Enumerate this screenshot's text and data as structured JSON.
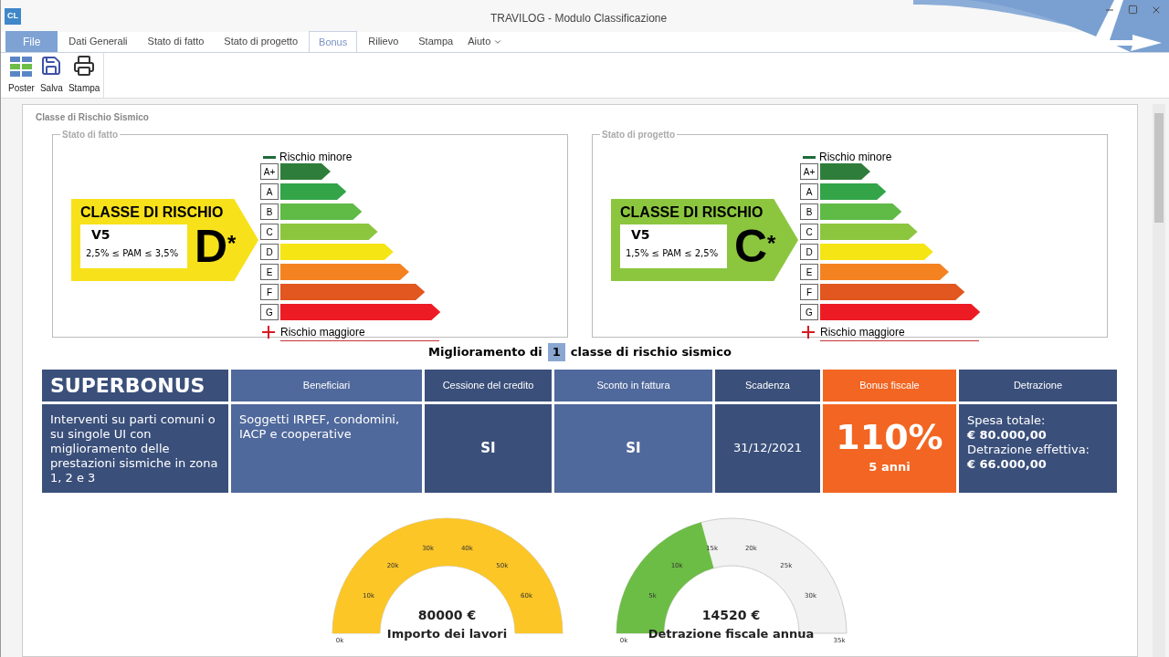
{
  "window": {
    "logo": "CL",
    "title": "TRAVILOG - Modulo Classificazione"
  },
  "tabs": [
    {
      "label": "File",
      "kind": "file",
      "selected": false
    },
    {
      "label": "Dati Generali",
      "kind": "tab",
      "selected": false
    },
    {
      "label": "Stato di fatto",
      "kind": "tab",
      "selected": false
    },
    {
      "label": "Stato di progetto",
      "kind": "tab",
      "selected": false
    },
    {
      "label": "Bonus",
      "kind": "tab",
      "selected": true
    },
    {
      "label": "Rilievo",
      "kind": "tab",
      "selected": false
    },
    {
      "label": "Stampa",
      "kind": "tab",
      "selected": false
    },
    {
      "label": "Aiuto",
      "kind": "menu",
      "selected": false
    }
  ],
  "toolbar": [
    {
      "label": "Poster",
      "kind": "poster"
    },
    {
      "label": "Salva",
      "kind": "save"
    },
    {
      "label": "Stampa",
      "kind": "print"
    }
  ],
  "section_title": "Classe di Rischio Sismico",
  "panels": [
    {
      "title": "Stato di fatto",
      "badge": {
        "heading": "CLASSE DI RISCHIO",
        "code": "V5",
        "range": "2,5% ≤ PAM ≤ 3,5%",
        "letter": "D$^{*}$",
        "color": "#f7e11a"
      },
      "legend_top": "Rischio minore",
      "legend_bottom": "Rischio maggiore",
      "classes": [
        {
          "label": "A+",
          "color": "#2f7d3b"
        },
        {
          "label": "A",
          "color": "#33a448"
        },
        {
          "label": "B",
          "color": "#5fba46"
        },
        {
          "label": "C",
          "color": "#8cc63f"
        },
        {
          "label": "D",
          "color": "#f6e514"
        },
        {
          "label": "E",
          "color": "#f58220"
        },
        {
          "label": "F",
          "color": "#e2561f"
        },
        {
          "label": "G",
          "color": "#ed1c24"
        }
      ]
    },
    {
      "title": "Stato di progetto",
      "badge": {
        "heading": "CLASSE DI RISCHIO",
        "code": "V5",
        "range": "1,5% ≤ PAM ≤ 2,5%",
        "letter": "C$^{*}$",
        "color": "#8cc63f"
      },
      "legend_top": "Rischio minore",
      "legend_bottom": "Rischio maggiore",
      "classes": [
        {
          "label": "A+",
          "color": "#2f7d3b"
        },
        {
          "label": "A",
          "color": "#33a448"
        },
        {
          "label": "B",
          "color": "#5fba46"
        },
        {
          "label": "C",
          "color": "#8cc63f"
        },
        {
          "label": "D",
          "color": "#f6e514"
        },
        {
          "label": "E",
          "color": "#f58220"
        },
        {
          "label": "F",
          "color": "#e2561f"
        },
        {
          "label": "G",
          "color": "#ed1c24"
        }
      ]
    }
  ],
  "improvement": {
    "prefix": "Miglioramento di",
    "count": "1",
    "suffix": "classe di rischio sismico"
  },
  "table": {
    "columns": [
      {
        "header": "SUPERBONUS",
        "kind": "title",
        "color": "#3a4f7a",
        "body": {
          "kind": "text",
          "text": "Interventi su parti comuni o su singole UI con miglioramento delle prestazioni sismiche in zona 1, 2 e 3"
        }
      },
      {
        "header": "Beneficiari",
        "kind": "label",
        "color": "#50699c",
        "body": {
          "kind": "top",
          "text": "Soggetti IRPEF, condomini, IACP e cooperative"
        }
      },
      {
        "header": "Cessione del credito",
        "kind": "label",
        "color": "#3a4f7a",
        "body": {
          "kind": "strong",
          "text": "SI"
        }
      },
      {
        "header": "Sconto in fattura",
        "kind": "label",
        "color": "#50699c",
        "body": {
          "kind": "strong",
          "text": "SI"
        }
      },
      {
        "header": "Scadenza",
        "kind": "label",
        "color": "#3a4f7a",
        "body": {
          "kind": "center",
          "text": "31/12/2021"
        }
      },
      {
        "header": "Bonus fiscale",
        "kind": "label",
        "color": "#f26522",
        "body": {
          "kind": "percent",
          "text": "110%",
          "note": "5 anni"
        }
      },
      {
        "header": "Detrazione",
        "kind": "label",
        "color": "#3a4f7a",
        "body": {
          "kind": "amounts",
          "lines": [
            {
              "label": "Spesa totale:",
              "value": "€ 80.000,00"
            },
            {
              "label": "Detrazione effettiva:",
              "value": "€ 66.000,00"
            }
          ]
        }
      }
    ]
  },
  "gauges": [
    {
      "value": "80000 €",
      "label": "Importo dei lavori",
      "level": 1,
      "color": "#fcc626",
      "kind": "open-end",
      "ticks": [
        "0k",
        "10k",
        "20k",
        "30k",
        "40k",
        "50k",
        "60k"
      ]
    },
    {
      "value": "14520 €",
      "label": "Detrazione fiscale annua",
      "level": 0.415,
      "color": "#6cbd45",
      "kind": "labeled-end",
      "ticks": [
        "0k",
        "5k",
        "10k",
        "15k",
        "20k",
        "25k",
        "30k",
        "35k"
      ]
    }
  ]
}
